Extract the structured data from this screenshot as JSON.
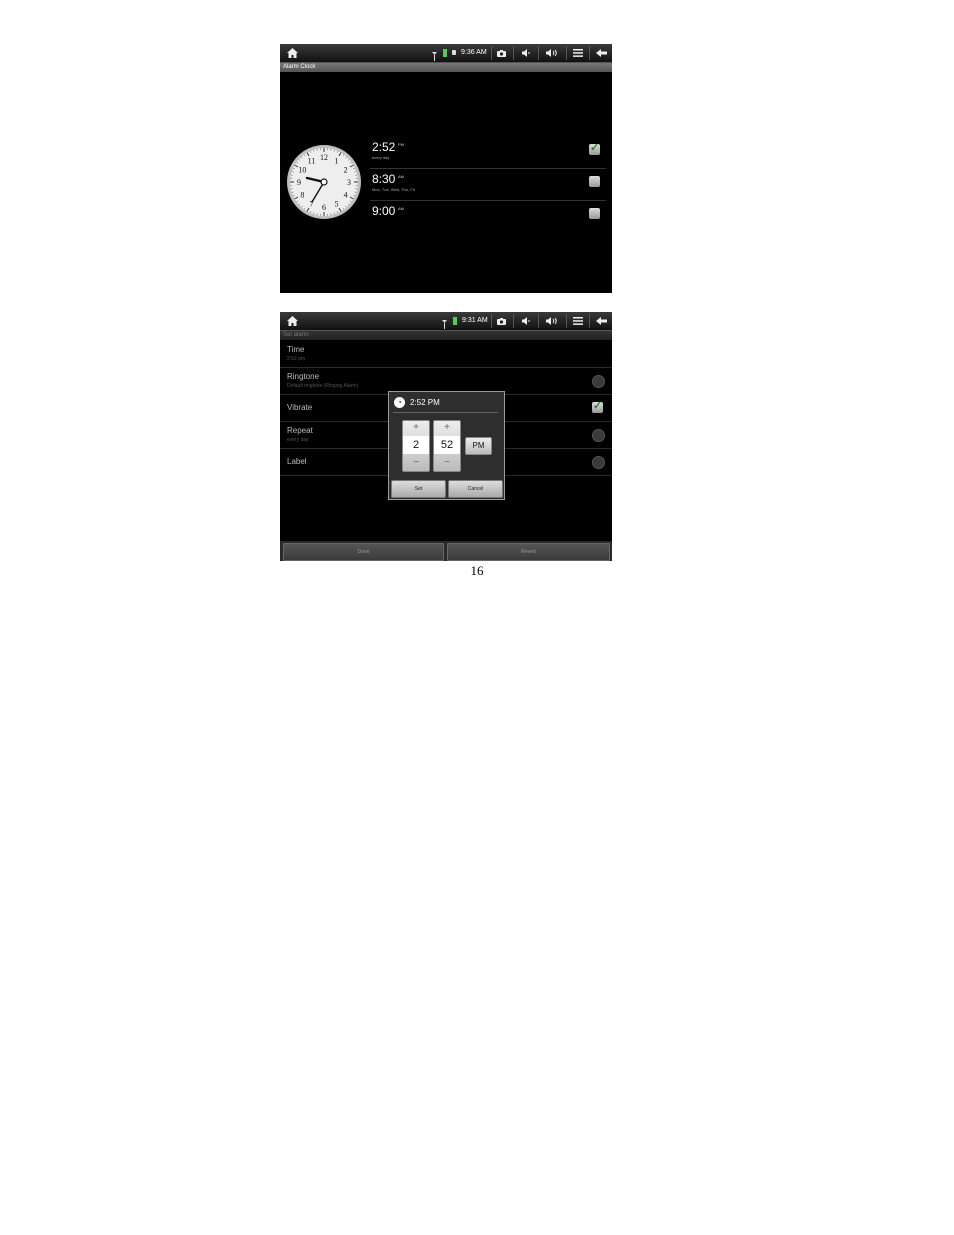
{
  "shot1": {
    "status_time": "9:36 AM",
    "title": "Alarm Clock",
    "clock_numbers": [
      "12",
      "1",
      "2",
      "3",
      "4",
      "5",
      "6",
      "7",
      "8",
      "9",
      "10",
      "11"
    ],
    "alarms": [
      {
        "time": "2:52",
        "ampm": "PM",
        "repeat": "every day",
        "enabled": true
      },
      {
        "time": "8:30",
        "ampm": "AM",
        "repeat": "Mon, Tue, Wed, Thu, Fri",
        "enabled": false
      },
      {
        "time": "9:00",
        "ampm": "AM",
        "repeat": "",
        "enabled": false
      }
    ]
  },
  "shot2": {
    "status_time": "9:31 AM",
    "title": "Set alarm",
    "settings": [
      {
        "label": "Time",
        "sub": "2:52 pm"
      },
      {
        "label": "Ringtone",
        "sub": "Default ringtone (Ringing Alarm)"
      },
      {
        "label": "Vibrate",
        "sub": ""
      },
      {
        "label": "Repeat",
        "sub": "every day"
      },
      {
        "label": "Label",
        "sub": ""
      }
    ],
    "dialog": {
      "title": "2:52 PM",
      "hour": "2",
      "minute": "52",
      "ampm": "PM",
      "plus": "+",
      "minus": "−",
      "set": "Set",
      "cancel": "Cancel"
    },
    "bottom": {
      "done": "Done",
      "revert": "Revert"
    }
  },
  "page_number": "16",
  "colors": {
    "check_green": "#2a8a2a",
    "battery_green": "#55cc55"
  }
}
